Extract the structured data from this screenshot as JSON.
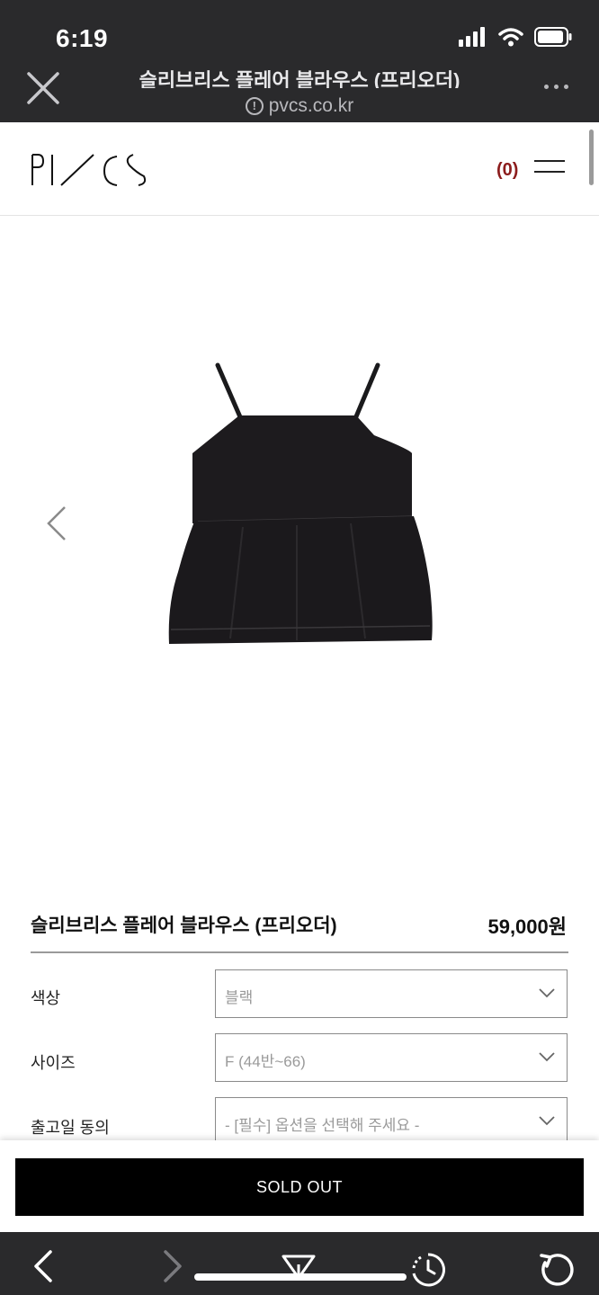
{
  "status_bar": {
    "time": "6:19"
  },
  "browser": {
    "page_title": "슬리브리스 플레어 블라우스 (프리오더)",
    "url": "pvcs.co.kr"
  },
  "site": {
    "logo_text": "PVCS",
    "cart_count": "(0)"
  },
  "product": {
    "name": "슬리브리스 플레어 블라우스 (프리오더)",
    "price": "59,000원"
  },
  "options": [
    {
      "label": "색상",
      "value": "블랙"
    },
    {
      "label": "사이즈",
      "value": "F (44반~66)"
    },
    {
      "label": "출고일 동의",
      "value": "- [필수] 옵션을 선택해 주세요 -"
    }
  ],
  "actions": {
    "sold_out_label": "SOLD OUT"
  },
  "colors": {
    "browser_chrome": "#2a2a2c",
    "cart_count": "#8c1c1c",
    "sold_out_button": "#000000"
  }
}
